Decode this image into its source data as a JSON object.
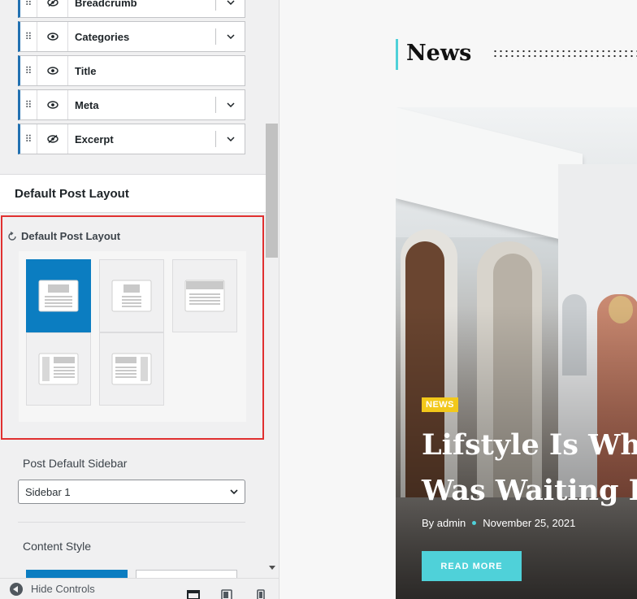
{
  "panel": {
    "elements": [
      {
        "label": "Breadcrumb",
        "visible": false,
        "expandable": true
      },
      {
        "label": "Categories",
        "visible": true,
        "expandable": true
      },
      {
        "label": "Title",
        "visible": true,
        "expandable": false
      },
      {
        "label": "Meta",
        "visible": true,
        "expandable": true
      },
      {
        "label": "Excerpt",
        "visible": false,
        "expandable": true
      }
    ],
    "section_title": "Default Post Layout",
    "layout_label": "Default Post Layout",
    "layout_options": [
      {
        "id": "full-width",
        "selected": true
      },
      {
        "id": "boxed",
        "selected": false
      },
      {
        "id": "wide",
        "selected": false
      },
      {
        "id": "left-sidebar",
        "selected": false
      },
      {
        "id": "right-sidebar",
        "selected": false
      }
    ],
    "sidebar_label": "Post Default Sidebar",
    "sidebar_value": "Sidebar 1",
    "content_style_label": "Content Style",
    "hide_controls": "Hide Controls",
    "accent_color": "#0b7dc1",
    "highlight_color": "#e03030"
  },
  "preview": {
    "section_title": "News",
    "category": "NEWS",
    "title_line1": "Lifstyle Is Wha",
    "title_line2": "Was Waiting Fo",
    "author": "By admin",
    "date": "November 25, 2021",
    "read_more": "READ MORE",
    "accent_color": "#4fd1d9",
    "badge_color": "#f2c81a"
  }
}
